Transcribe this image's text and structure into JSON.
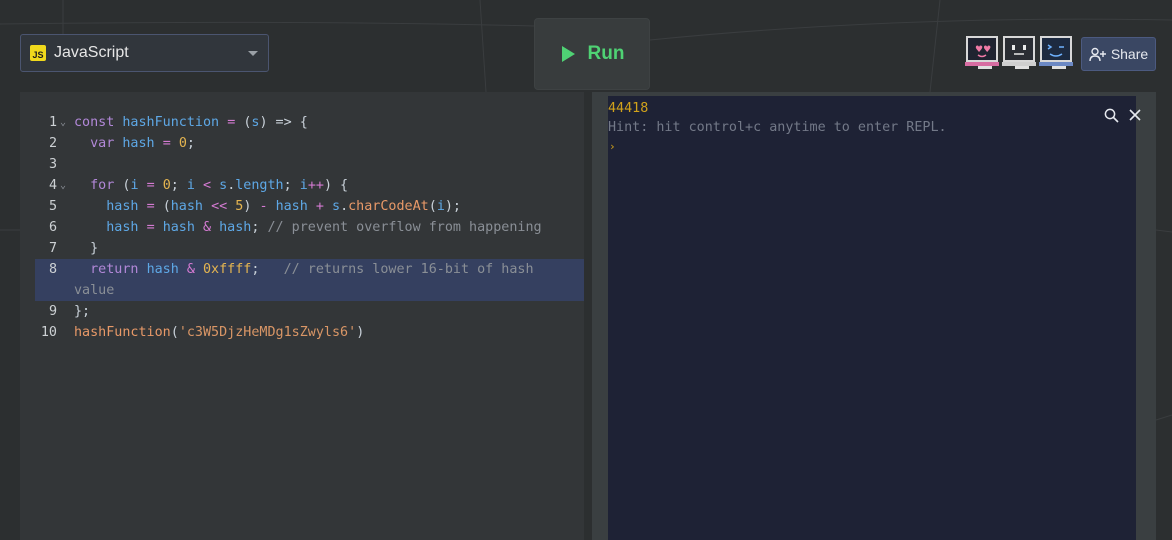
{
  "toolbar": {
    "language": {
      "badge": "JS",
      "label": "JavaScript"
    },
    "run_label": "Run",
    "share_label": "Share",
    "avatars": [
      "avatar-pink-face",
      "avatar-gray-face",
      "avatar-blue-face"
    ]
  },
  "editor": {
    "line_numbers": [
      "1",
      "2",
      "3",
      "4",
      "5",
      "6",
      "7",
      "8",
      "9",
      "10"
    ],
    "active_line": "8"
  },
  "console": {
    "output": "44418",
    "hint": "Hint: hit control+c anytime to enter REPL.",
    "prompt": "›"
  },
  "colors": {
    "accent_green": "#4fd274",
    "keyword": "#b288d8",
    "function": "#5ea8e6",
    "number": "#e5b550",
    "string": "#d99666",
    "console_output": "#d1a21b"
  }
}
